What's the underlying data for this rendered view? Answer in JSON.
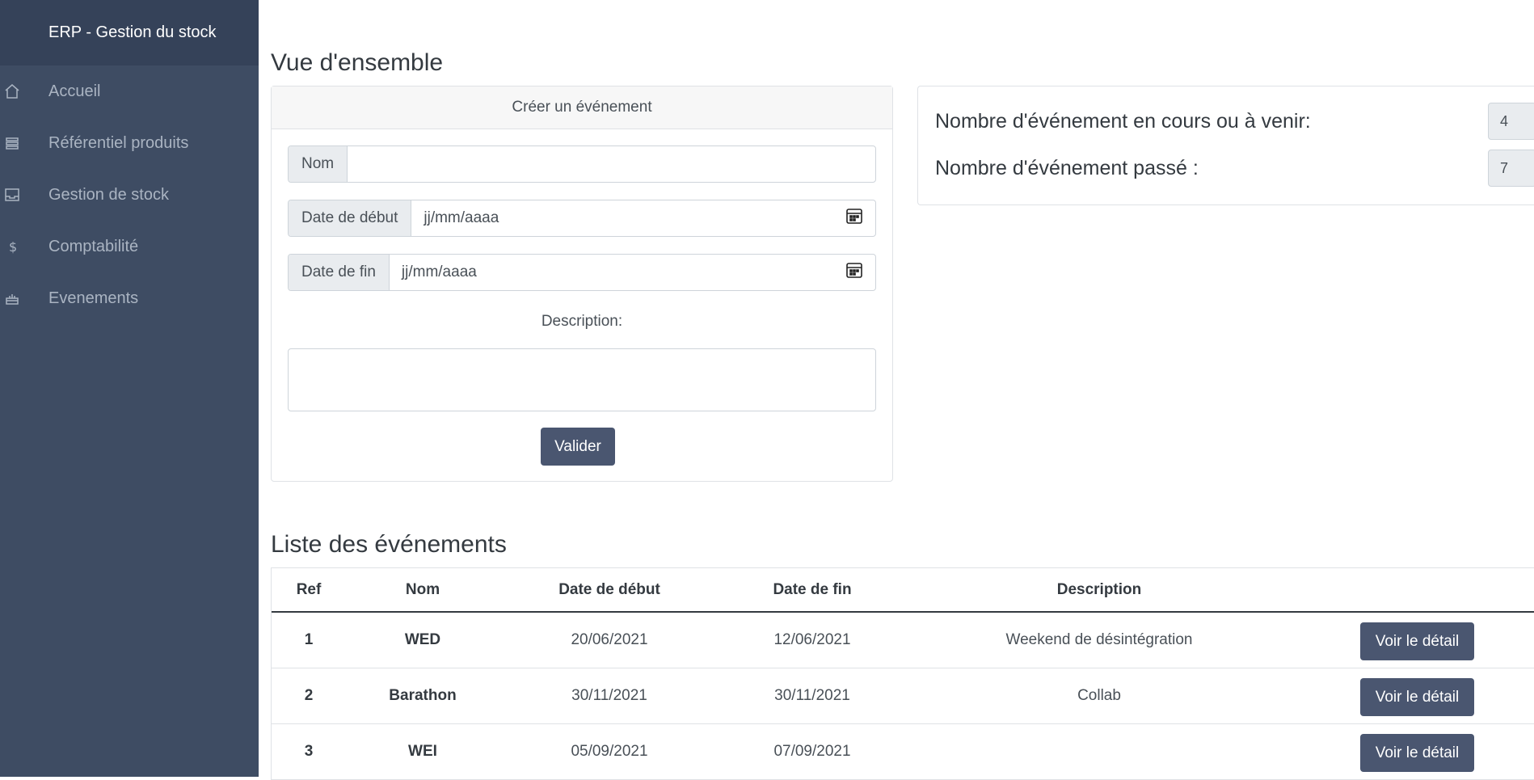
{
  "sidebar": {
    "brand": "ERP - Gestion du stock",
    "items": [
      {
        "label": "Accueil",
        "icon": "home-icon"
      },
      {
        "label": "Référentiel produits",
        "icon": "layers-icon"
      },
      {
        "label": "Gestion de stock",
        "icon": "inbox-icon"
      },
      {
        "label": "Comptabilité",
        "icon": "dollar-icon"
      },
      {
        "label": "Evenements",
        "icon": "cake-icon"
      }
    ]
  },
  "overview": {
    "title": "Vue d'ensemble"
  },
  "create_form": {
    "header": "Créer un événement",
    "nom_label": "Nom",
    "nom_value": "",
    "start_label": "Date de début",
    "start_placeholder": "jj/mm/aaaa",
    "end_label": "Date de fin",
    "end_placeholder": "jj/mm/aaaa",
    "description_label": "Description:",
    "description_value": "",
    "submit_label": "Valider"
  },
  "stats": {
    "current_label": "Nombre d'événement en cours ou à venir:",
    "current_value": "4",
    "past_label": "Nombre d'événement passé :",
    "past_value": "7"
  },
  "events_list": {
    "title": "Liste des événements",
    "columns": [
      "Ref",
      "Nom",
      "Date de début",
      "Date de fin",
      "Description"
    ],
    "rows": [
      {
        "ref": "1",
        "nom": "WED",
        "debut": "20/06/2021",
        "fin": "12/06/2021",
        "description": "Weekend de désintégration",
        "action": "Voir le détail"
      },
      {
        "ref": "2",
        "nom": "Barathon",
        "debut": "30/11/2021",
        "fin": "30/11/2021",
        "description": "Collab",
        "action": "Voir le détail"
      },
      {
        "ref": "3",
        "nom": "WEI",
        "debut": "05/09/2021",
        "fin": "07/09/2021",
        "description": "",
        "action": "Voir le détail"
      }
    ]
  },
  "colors": {
    "sidebar_bg": "#3e4c63",
    "brand_bg": "#354259",
    "button_bg": "#4a5670"
  }
}
